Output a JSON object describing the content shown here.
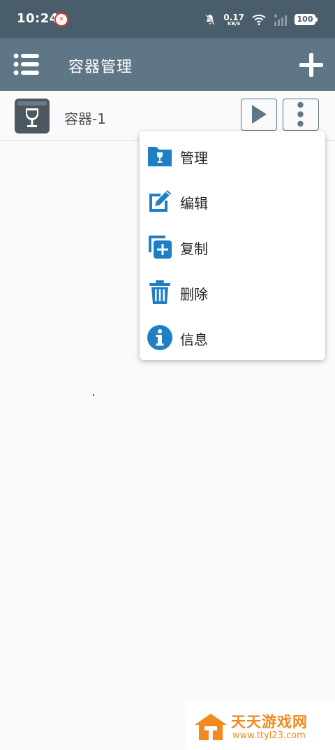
{
  "status_bar": {
    "time": "10:24",
    "net_speed": "0.17",
    "net_unit": "KB/S",
    "battery": "100",
    "app_icon": "app-notification-icon"
  },
  "app_bar": {
    "title": "容器管理",
    "menu_icon": "menu-list-icon",
    "add_icon": "plus-icon"
  },
  "containers": [
    {
      "name": "容器-1",
      "icon": "wine-glass-icon",
      "run_icon": "play-icon",
      "more_icon": "more-vertical-icon"
    }
  ],
  "popup_menu": {
    "items": [
      {
        "label": "管理",
        "icon": "folder-wine-icon"
      },
      {
        "label": "编辑",
        "icon": "edit-icon"
      },
      {
        "label": "复制",
        "icon": "copy-add-icon"
      },
      {
        "label": "删除",
        "icon": "trash-icon"
      },
      {
        "label": "信息",
        "icon": "info-icon"
      }
    ]
  },
  "watermark": {
    "name": "天天游戏网",
    "url": "www.ttyl23.com"
  },
  "colors": {
    "status_bar": "#4a5d6b",
    "app_bar": "#5f7686",
    "menu_icon_blue": "#1e7fc5",
    "watermark_orange": "#f28a1e"
  }
}
